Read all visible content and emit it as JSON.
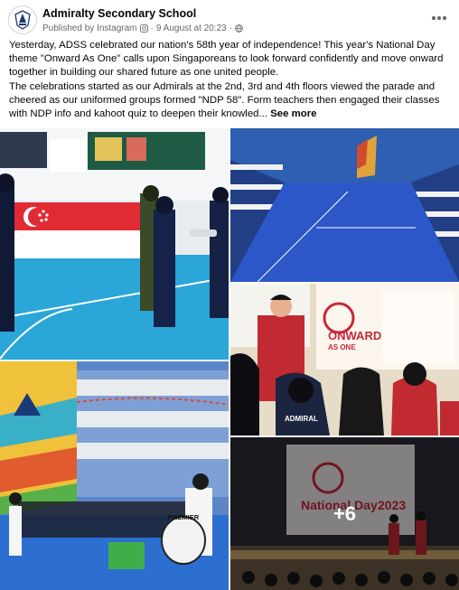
{
  "post": {
    "author": "Admiralty Secondary School",
    "published_via": "Published by Instagram",
    "date": "9 August at 20:23",
    "separator": "·",
    "text_para1": "Yesterday, ADSS celebrated our nation's 58th year of independence! This year's National Day theme \"Onward As One\" calls upon Singaporeans to look forward confidently and move onward together in building our shared future as one united people.",
    "text_para2": "The celebrations started as our Admirals at the 2nd, 3rd and 4th floors viewed the parade and cheered as our uniformed groups formed \"NDP 58\". Form teachers then engaged their classes with NDP info and kahoot quiz to deepen their knowled...",
    "see_more": "See more"
  },
  "icons": {
    "avatar": "school-crest-icon",
    "instagram": "instagram-icon",
    "audience": "globe-icon",
    "more": "more-options-icon"
  },
  "photos": {
    "photo5_banner_line1": "National Day",
    "photo5_banner_line2": "2023",
    "photo4_drum": "PREMIER",
    "photo3_board_line1": "ONWARD",
    "photo3_board_line2": "AS ONE",
    "photo3_shirt": "ADMIRAL",
    "more_count": "+6"
  }
}
